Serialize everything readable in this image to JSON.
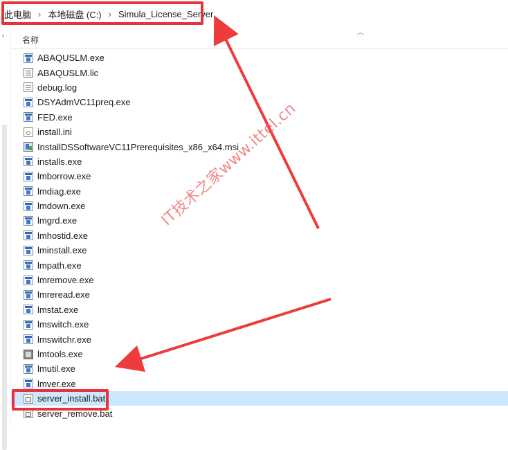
{
  "breadcrumb": {
    "items": [
      "此电脑",
      "本地磁盘 (C:)",
      "Simula_License_Server"
    ],
    "separator_icon": "chevron-right-icon"
  },
  "column_header": {
    "name_label": "名称",
    "sort_icon": "sort-ascending-icon"
  },
  "files": [
    {
      "name": "ABAQUSLM.exe",
      "icon": "exe-icon"
    },
    {
      "name": "ABAQUSLM.lic",
      "icon": "license-file-icon"
    },
    {
      "name": "debug.log",
      "icon": "text-file-icon"
    },
    {
      "name": "DSYAdmVC11preq.exe",
      "icon": "exe-icon"
    },
    {
      "name": "FED.exe",
      "icon": "exe-icon"
    },
    {
      "name": "install.ini",
      "icon": "config-file-icon"
    },
    {
      "name": "InstallDSSoftwareVC11Prerequisites_x86_x64.msi",
      "icon": "msi-installer-icon"
    },
    {
      "name": "installs.exe",
      "icon": "exe-icon"
    },
    {
      "name": "lmborrow.exe",
      "icon": "exe-icon"
    },
    {
      "name": "lmdiag.exe",
      "icon": "exe-icon"
    },
    {
      "name": "lmdown.exe",
      "icon": "exe-icon"
    },
    {
      "name": "lmgrd.exe",
      "icon": "exe-icon"
    },
    {
      "name": "lmhostid.exe",
      "icon": "exe-icon"
    },
    {
      "name": "lminstall.exe",
      "icon": "exe-icon"
    },
    {
      "name": "lmpath.exe",
      "icon": "exe-icon"
    },
    {
      "name": "lmremove.exe",
      "icon": "exe-icon"
    },
    {
      "name": "lmreread.exe",
      "icon": "exe-icon"
    },
    {
      "name": "lmstat.exe",
      "icon": "exe-icon"
    },
    {
      "name": "lmswitch.exe",
      "icon": "exe-icon"
    },
    {
      "name": "lmswitchr.exe",
      "icon": "exe-icon"
    },
    {
      "name": "lmtools.exe",
      "icon": "tools-exe-icon"
    },
    {
      "name": "lmutil.exe",
      "icon": "exe-icon"
    },
    {
      "name": "lmver.exe",
      "icon": "exe-icon"
    },
    {
      "name": "server_install.bat",
      "icon": "batch-file-icon",
      "selected": true
    },
    {
      "name": "server_remove.bat",
      "icon": "batch-file-icon"
    }
  ],
  "watermark": "IT技术之家www.ittel.cn",
  "colors": {
    "highlight_red": "#e8333a",
    "selection_blue": "#cce8ff",
    "header_blue": "#eaf3fb"
  }
}
